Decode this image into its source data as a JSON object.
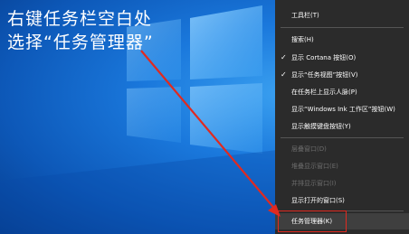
{
  "annotation": {
    "line1": "右键任务栏空白处",
    "line2": "选择“任务管理器”"
  },
  "menu": {
    "items": [
      {
        "label": "工具栏(T)",
        "checked": false,
        "disabled": false
      },
      {
        "label": "搜索(H)",
        "checked": false,
        "disabled": false
      },
      {
        "label": "显示 Cortana 按钮(O)",
        "checked": true,
        "disabled": false
      },
      {
        "label": "显示“任务视图”按钮(V)",
        "checked": true,
        "disabled": false
      },
      {
        "label": "在任务栏上显示人脉(P)",
        "checked": false,
        "disabled": false
      },
      {
        "label": "显示“Windows Ink 工作区”按钮(W)",
        "checked": false,
        "disabled": false
      },
      {
        "label": "显示触摸键盘按钮(Y)",
        "checked": false,
        "disabled": false
      },
      {
        "label": "层叠窗口(D)",
        "checked": false,
        "disabled": true
      },
      {
        "label": "堆叠显示窗口(E)",
        "checked": false,
        "disabled": true
      },
      {
        "label": "并排显示窗口(I)",
        "checked": false,
        "disabled": true
      },
      {
        "label": "显示打开的窗口(S)",
        "checked": false,
        "disabled": false
      },
      {
        "label": "任务管理器(K)",
        "checked": false,
        "disabled": false
      }
    ]
  },
  "colors": {
    "menu_bg": "#2b2b2b",
    "highlight_border": "#e02a20",
    "arrow": "#e02a20"
  }
}
